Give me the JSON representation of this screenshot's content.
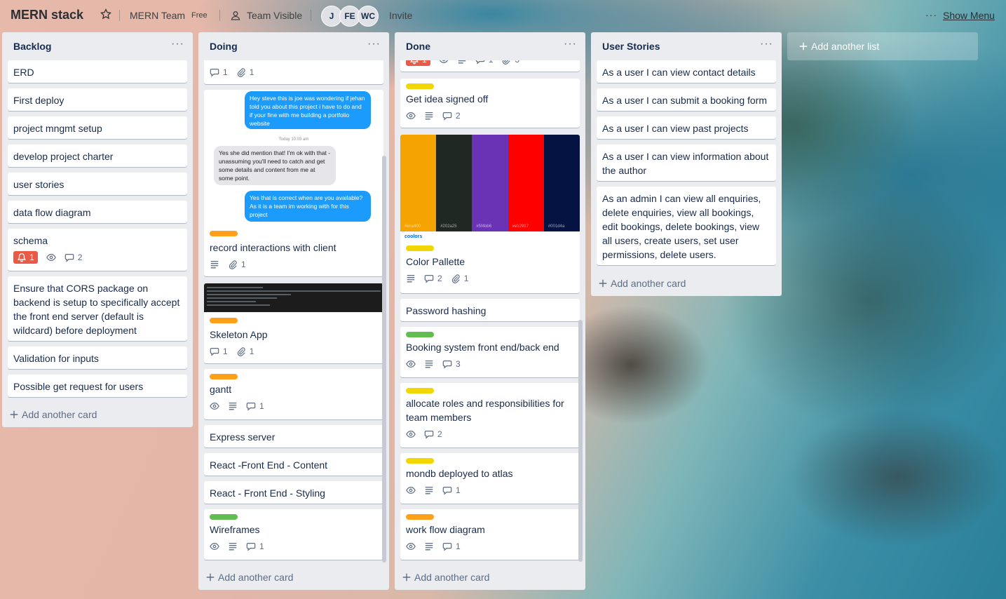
{
  "header": {
    "board_title": "MERN stack",
    "team_name": "MERN Team",
    "team_plan": "Free",
    "visibility": "Team Visible",
    "members": [
      "J",
      "FE",
      "WC"
    ],
    "invite": "Invite",
    "menu_dots": "···",
    "show_menu": "Show Menu"
  },
  "colors": {
    "label_orange": "#ff9f1a",
    "label_yellow": "#f2d600",
    "label_green": "#61bd4f",
    "notif_red": "#eb5a46"
  },
  "lists": {
    "backlog": {
      "title": "Backlog",
      "menu": "···",
      "add_card": "Add another card",
      "cards": {
        "c0": {
          "title": "ERD"
        },
        "c1": {
          "title": "First deploy"
        },
        "c2": {
          "title": "project mngmt setup"
        },
        "c3": {
          "title": "develop project charter"
        },
        "c4": {
          "title": "user stories"
        },
        "c5": {
          "title": "data flow diagram"
        },
        "c6": {
          "title": "schema",
          "notif": "1",
          "comments": "2"
        },
        "c7": {
          "title": "Ensure that CORS package on backend is setup to specifically accept the front end server (default is wildcard) before deployment"
        },
        "c8": {
          "title": "Validation for inputs"
        },
        "c9": {
          "title": "Possible get request for users"
        }
      }
    },
    "doing": {
      "title": "Doing",
      "menu": "···",
      "add_card": "Add another card",
      "cards": {
        "c0": {
          "comments": "1",
          "attachments": "1"
        },
        "c1": {
          "title": "record interactions with client",
          "attachments": "1",
          "chat": {
            "msg1": "Hey steve this is joe was wondering if jehan told you about this project i have to do and if your fine with me building a portfolio website",
            "time": "Today 10:03 am",
            "msg2": "Yes she did mention that! I'm ok with that - unassuming you'll need to catch and get some details and content from me at some point.",
            "msg3": "Yes that is correct when are you available? As it is a team im working with for this project"
          }
        },
        "c2": {
          "title": "Skeleton App",
          "comments": "1",
          "attachments": "1"
        },
        "c3": {
          "title": "gantt",
          "comments": "1"
        },
        "c4": {
          "title": "Express server"
        },
        "c5": {
          "title": "React -Front End - Content"
        },
        "c6": {
          "title": "React - Front End - Styling"
        },
        "c7": {
          "title": "Wireframes",
          "comments": "1"
        }
      }
    },
    "done": {
      "title": "Done",
      "menu": "···",
      "add_card": "Add another card",
      "cards": {
        "c0": {
          "notif": "1",
          "comments": "1",
          "attachments": "3"
        },
        "c1": {
          "title": "Get idea signed off",
          "comments": "2"
        },
        "c2": {
          "title": "Color Pallette",
          "comments": "2",
          "attachments": "1",
          "brand": "coolors",
          "swatches": [
            {
              "color": "#f4a300",
              "hex": "#eca400"
            },
            {
              "color": "#1f2823",
              "hex": "#202a25"
            },
            {
              "color": "#6a33b5",
              "hex": "#5f4bb6"
            },
            {
              "color": "#ff0000",
              "hex": "#e12917"
            },
            {
              "color": "#041341",
              "hex": "#001d4a"
            }
          ]
        },
        "c3": {
          "title": "Password hashing"
        },
        "c4": {
          "title": "Booking system front end/back end",
          "comments": "3"
        },
        "c5": {
          "title": "allocate roles and responsibilities for team members",
          "comments": "2"
        },
        "c6": {
          "title": "mondb deployed to atlas",
          "comments": "1"
        },
        "c7": {
          "title": "work flow diagram",
          "comments": "1"
        }
      }
    },
    "stories": {
      "title": "User Stories",
      "menu": "···",
      "add_card": "Add another card",
      "cards": {
        "c0": {
          "title": "As a user I can view contact details"
        },
        "c1": {
          "title": "As a user I can submit a booking form"
        },
        "c2": {
          "title": "As a user I can view past projects"
        },
        "c3": {
          "title": "As a user I can view information about the author"
        },
        "c4": {
          "title": "As an admin I can view all enquiries, delete enquiries, view all bookings, edit bookings, delete bookings, view all users, create users, set user permissions, delete users."
        }
      }
    }
  },
  "add_list": "Add another list"
}
